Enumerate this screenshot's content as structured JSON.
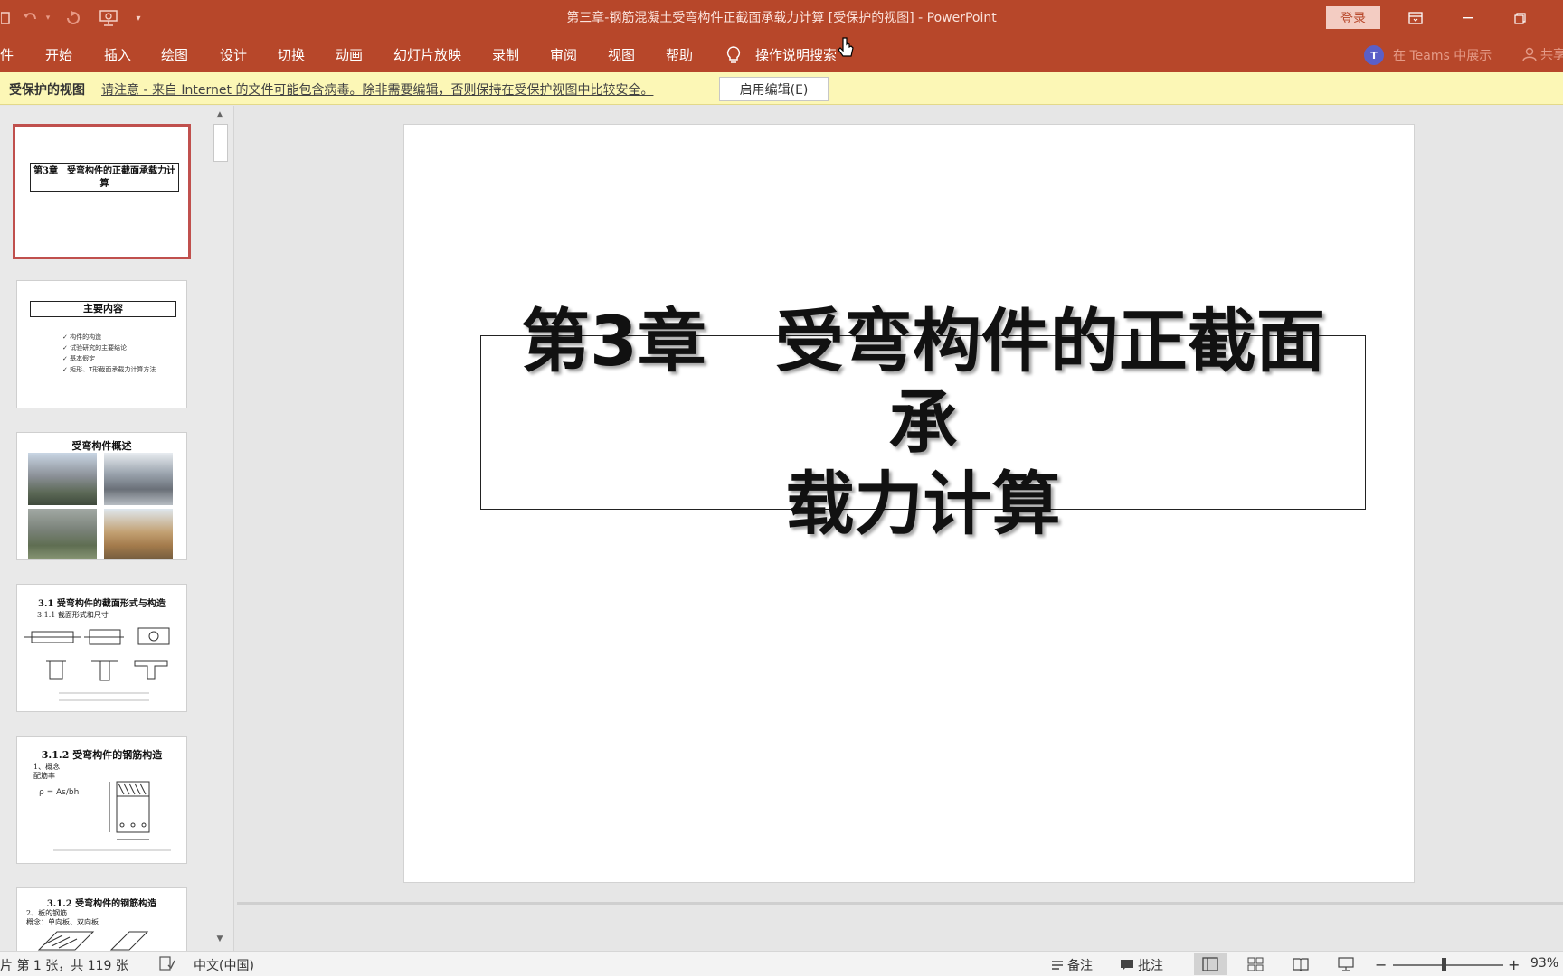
{
  "window": {
    "title": "第三章-钢筋混凝土受弯构件正截面承载力计算 [受保护的视图]  -  PowerPoint",
    "login_label": "登录",
    "controls": [
      "ribbon-display",
      "minimize",
      "restore"
    ]
  },
  "ribbon": {
    "tabs": [
      "件",
      "开始",
      "插入",
      "绘图",
      "设计",
      "切换",
      "动画",
      "幻灯片放映",
      "录制",
      "审阅",
      "视图",
      "帮助"
    ],
    "tell_me": "操作说明搜索",
    "teams": "在 Teams 中展示",
    "share": "共享"
  },
  "protected_view": {
    "label": "受保护的视图",
    "message": "请注意 - 来自 Internet 的文件可能包含病毒。除非需要编辑，否则保持在受保护视图中比较安全。",
    "enable_button": "启用编辑(E)"
  },
  "thumbnails": [
    {
      "title": "第3章　受弯构件的正截面承载力计算"
    },
    {
      "title": "主要内容",
      "items": [
        "构件的构造",
        "试验研究的主要结论",
        "基本假定",
        "矩形、T形截面承载力计算方法"
      ]
    },
    {
      "title": "受弯构件概述"
    },
    {
      "title": "3.1  受弯构件的截面形式与构造",
      "subtitle": "3.1.1 截面形式和尺寸"
    },
    {
      "title": "3.1.2  受弯构件的钢筋构造",
      "subtitle": "1、概念",
      "subtitle2": "配筋率"
    },
    {
      "title": "3.1.2  受弯构件的钢筋构造",
      "subtitle": "2、板的钢筋",
      "subtitle2": "概念：单向板、双向板"
    }
  ],
  "slide": {
    "title_line1": "第3章　受弯构件的正截面承",
    "title_line2": "载力计算"
  },
  "status": {
    "slide_info": "片 第 1 张，共 119 张",
    "language": "中文(中国)",
    "notes": "备注",
    "comments": "批注",
    "zoom_level": "93%"
  },
  "colors": {
    "ribbon": "#b7472a",
    "protected_bar": "#fcf7b6",
    "selected_thumb": "#c0504d"
  }
}
